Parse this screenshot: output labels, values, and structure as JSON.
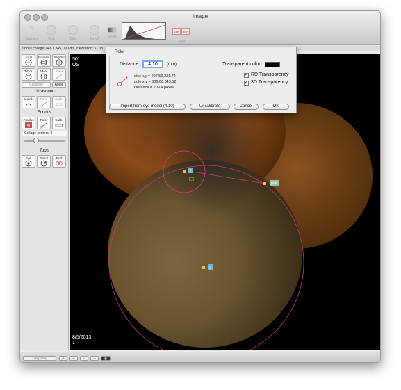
{
  "window": {
    "title": "Image"
  },
  "toolbar": {
    "items": [
      {
        "label": "Camera"
      },
      {
        "label": "Run"
      },
      {
        "label": "Dim"
      },
      {
        "label": "Level"
      },
      {
        "label": "Reset"
      }
    ],
    "eye_label": "Eye",
    "eye_buttons": [
      "Left",
      "Right"
    ]
  },
  "status": {
    "text": "fundus collage: 848 x 845, 100 dpi, calibration: 51.08"
  },
  "sidebar": {
    "row1": [
      "Axial",
      "Equator",
      "Sagittal"
    ],
    "row2": [
      "T-Cor.",
      "T-Mer.",
      "Ruler"
    ],
    "calibrate_label": "Calibrate",
    "angle_label": "Angle",
    "ultrasound_title": "Ultrasound",
    "ultrasound_tools": [
      "U.Srd.",
      "Ruler",
      "Calib."
    ],
    "fundus_title": "Fundus",
    "fundus_tools": [
      "Fundus",
      "Ruler",
      "Calib."
    ],
    "collage_label": "Collage centers: 3",
    "tools_title": "Tools",
    "tools": [
      "Eye",
      "Tumor",
      "Find"
    ]
  },
  "image": {
    "angle": "50°",
    "eye": "OS",
    "date": "8/5/2013",
    "index": "1",
    "marker_2": "2",
    "marker_3": "3",
    "pole_label": "pole"
  },
  "bottom_bar": {
    "zoom_text": "1.00 (100%)"
  },
  "dialog": {
    "title": "Ruler",
    "distance_label": "Distance:",
    "distance_value": "4.10",
    "distance_unit": "(mm)",
    "transparent_color_label": "Transparent color:",
    "rd_label": "RD Transparency",
    "td_label": "3D Transparency",
    "info_disc": "disc x,y = 297.59,331.74",
    "info_pole": "pole x,y = 506.68,343.52",
    "info_distance": "Distance = 209.4 pixels",
    "btn_import": "Import from eye model (4.10)",
    "btn_uncalibrate": "Uncalibrate",
    "btn_cancel": "Cancel",
    "btn_ok": "OK"
  },
  "colors": {
    "accent": "#7fa8e0",
    "overlay": "#c83a6e",
    "marker": "#f0c040"
  }
}
